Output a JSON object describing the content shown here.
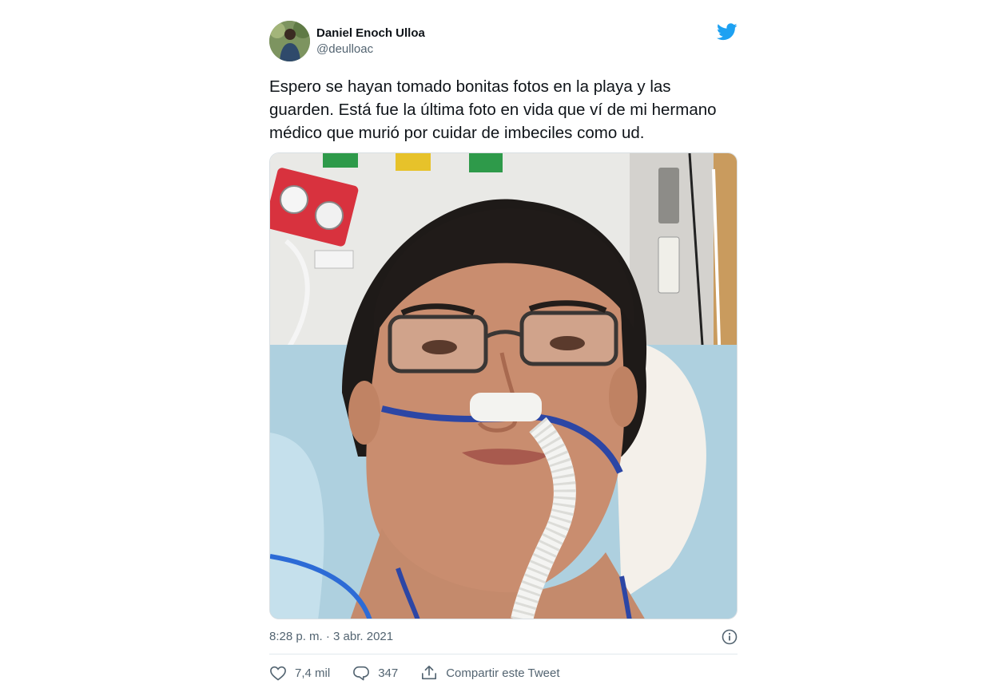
{
  "tweet": {
    "author": {
      "display_name": "Daniel Enoch Ulloa",
      "handle": "@deulloac",
      "avatar_icon": "avatar-photo"
    },
    "platform_icon": "twitter-bird-icon",
    "accent_color": "#1da1f2",
    "text": "Espero se hayan tomado bonitas fotos en la playa y las\nguarden. Está fue la última foto en vida que ví de mi hermano\nmédico que murió por cuidar de imbeciles como ud.",
    "timestamp": "8:28 p. m. · 3 abr. 2021",
    "info_icon": "info-icon",
    "actions": {
      "likes": "7,4 mil",
      "replies": "347",
      "share_label": "Compartir este Tweet"
    }
  }
}
